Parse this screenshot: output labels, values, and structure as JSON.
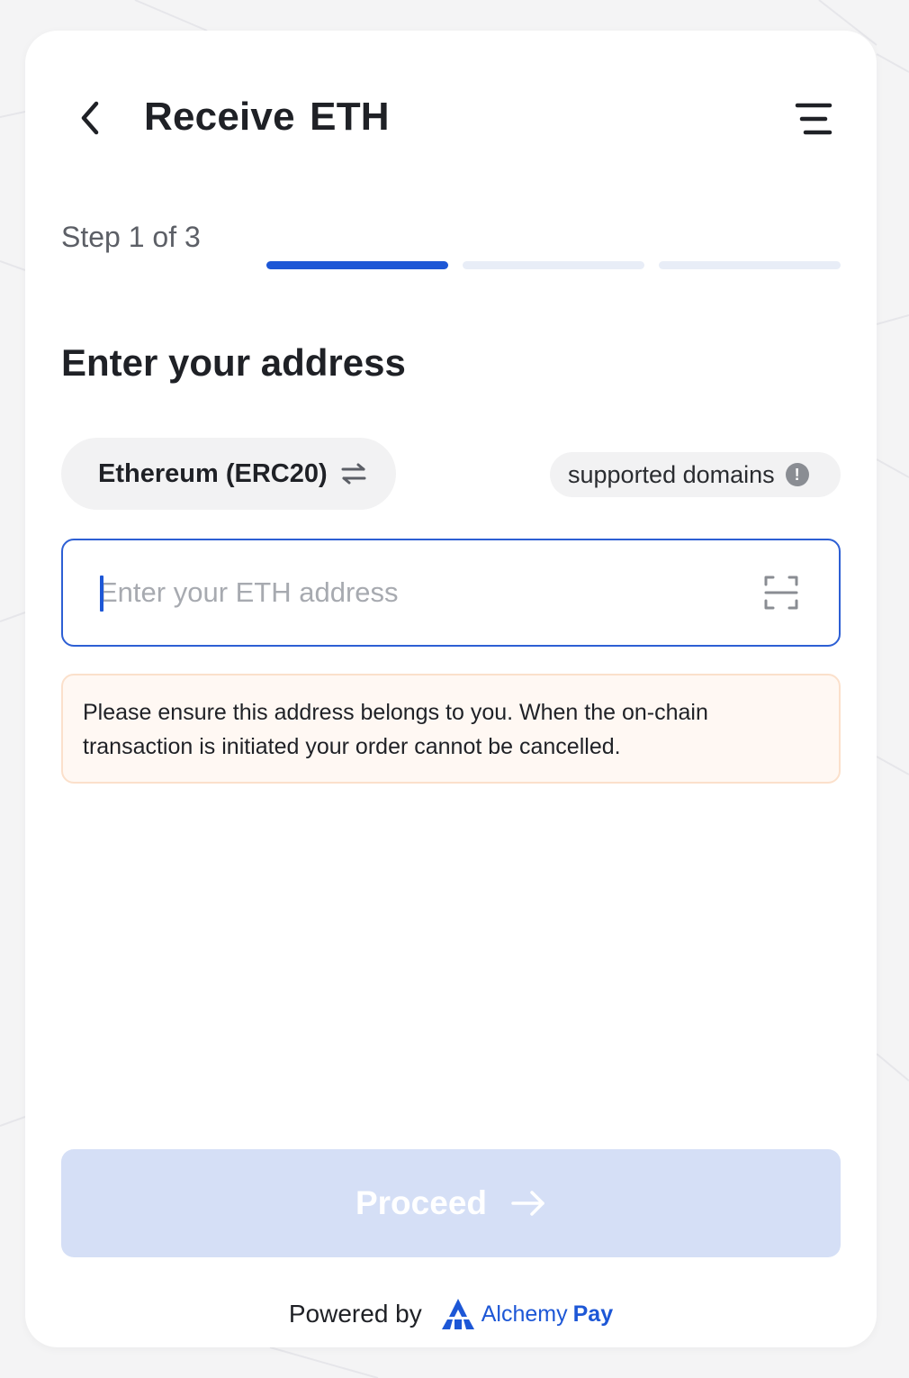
{
  "header": {
    "title": "Receive ETH",
    "back_icon": "chevron-left-icon",
    "menu_icon": "menu-icon"
  },
  "progress": {
    "label": "Step 1 of 3",
    "current_step": 1,
    "total_steps": 3,
    "active_color": "#1d57d6",
    "inactive_color": "#e8edf7"
  },
  "form": {
    "section_title": "Enter your address",
    "network_label": "Ethereum (ERC20)",
    "network_icon": "swap-arrows-icon",
    "domains_label": "supported domains",
    "domains_icon": "info-icon",
    "address_value": "",
    "address_placeholder": "Enter your ETH address",
    "scan_icon": "scan-icon"
  },
  "notice": {
    "text": "Please ensure this address belongs to you. When the on-chain transaction is initiated your order cannot be cancelled."
  },
  "actions": {
    "proceed_label": "Proceed",
    "proceed_icon": "arrow-right-icon",
    "proceed_enabled": false
  },
  "footer": {
    "powered_by": "Powered by",
    "brand_part1": "Alchemy",
    "brand_part2": "Pay",
    "brand_color": "#1d57d6"
  }
}
